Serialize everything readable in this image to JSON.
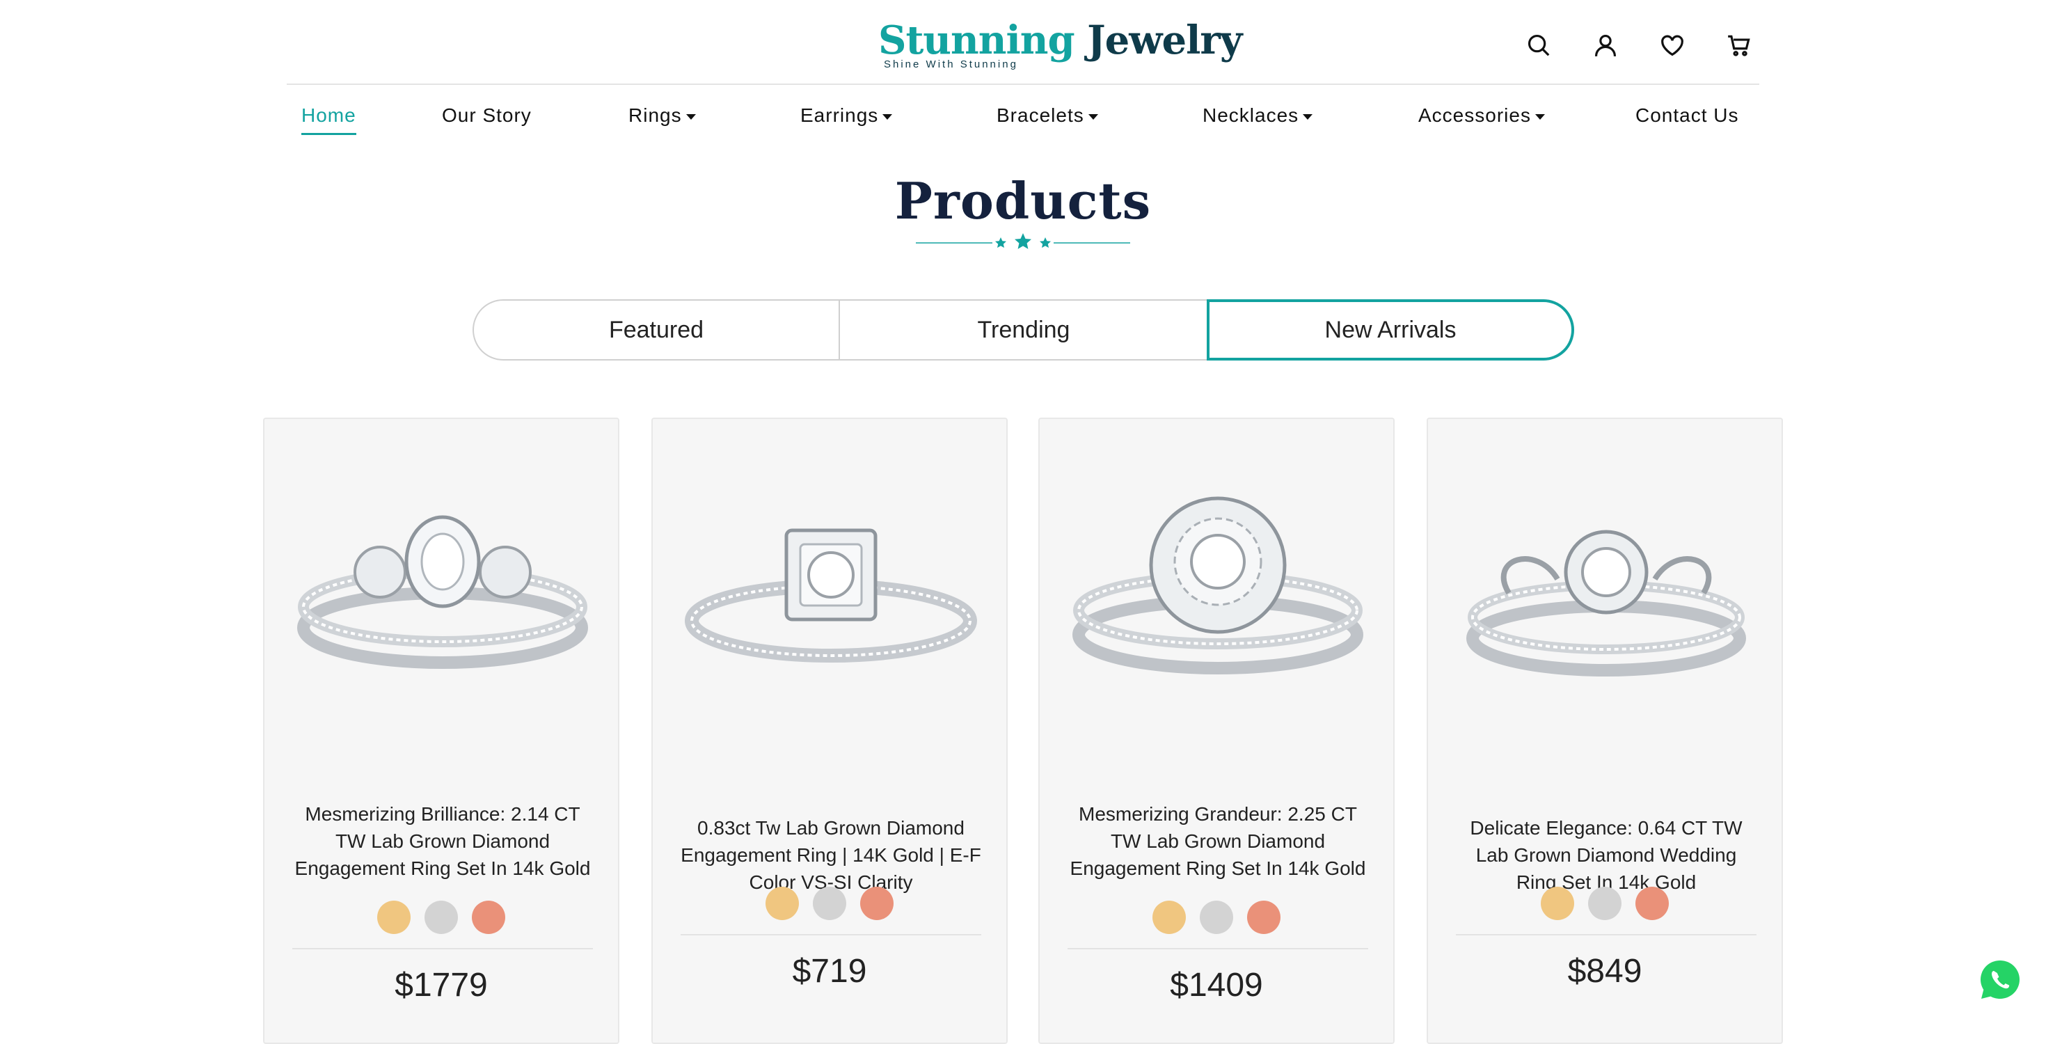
{
  "brand": {
    "name_part1": "Stunning",
    "name_part2": "Jewelry",
    "tagline": "Shine With Stunning"
  },
  "header_icons": [
    "search-icon",
    "user-icon",
    "heart-icon",
    "cart-icon"
  ],
  "nav": [
    {
      "label": "Home",
      "active": true,
      "dropdown": false
    },
    {
      "label": "Our Story",
      "dropdown": false
    },
    {
      "label": "Rings",
      "dropdown": true
    },
    {
      "label": "Earrings",
      "dropdown": true
    },
    {
      "label": "Bracelets",
      "dropdown": true
    },
    {
      "label": "Necklaces",
      "dropdown": true
    },
    {
      "label": "Accessories",
      "dropdown": true
    },
    {
      "label": "Contact Us",
      "dropdown": false
    }
  ],
  "section": {
    "title": "Products"
  },
  "tabs": [
    {
      "label": "Featured"
    },
    {
      "label": "Trending"
    },
    {
      "label": "New Arrivals",
      "active": true
    }
  ],
  "products": [
    {
      "title": "Mesmerizing Brilliance: 2.14 CT TW Lab Grown Diamond Engagement Ring Set In 14k Gold",
      "price": "$1779",
      "swatches": [
        "#f0c680",
        "#d3d3d3",
        "#ea9179"
      ]
    },
    {
      "title": "0.83ct Tw Lab Grown Diamond Engagement Ring | 14K Gold | E-F Color VS-SI Clarity",
      "price": "$719",
      "swatches": [
        "#f0c680",
        "#d3d3d3",
        "#ea9179"
      ]
    },
    {
      "title": "Mesmerizing Grandeur: 2.25 CT TW Lab Grown Diamond Engagement Ring Set In 14k Gold",
      "price": "$1409",
      "swatches": [
        "#f0c680",
        "#d3d3d3",
        "#ea9179"
      ]
    },
    {
      "title": "Delicate Elegance: 0.64 CT TW Lab Grown Diamond Wedding Ring Set In 14k Gold",
      "price": "$849",
      "swatches": [
        "#f0c680",
        "#d3d3d3",
        "#ea9179"
      ]
    }
  ],
  "colors": {
    "accent": "#13a3a0",
    "brand_dark": "#0f3b4a",
    "title": "#14213d",
    "whatsapp": "#25d366"
  }
}
